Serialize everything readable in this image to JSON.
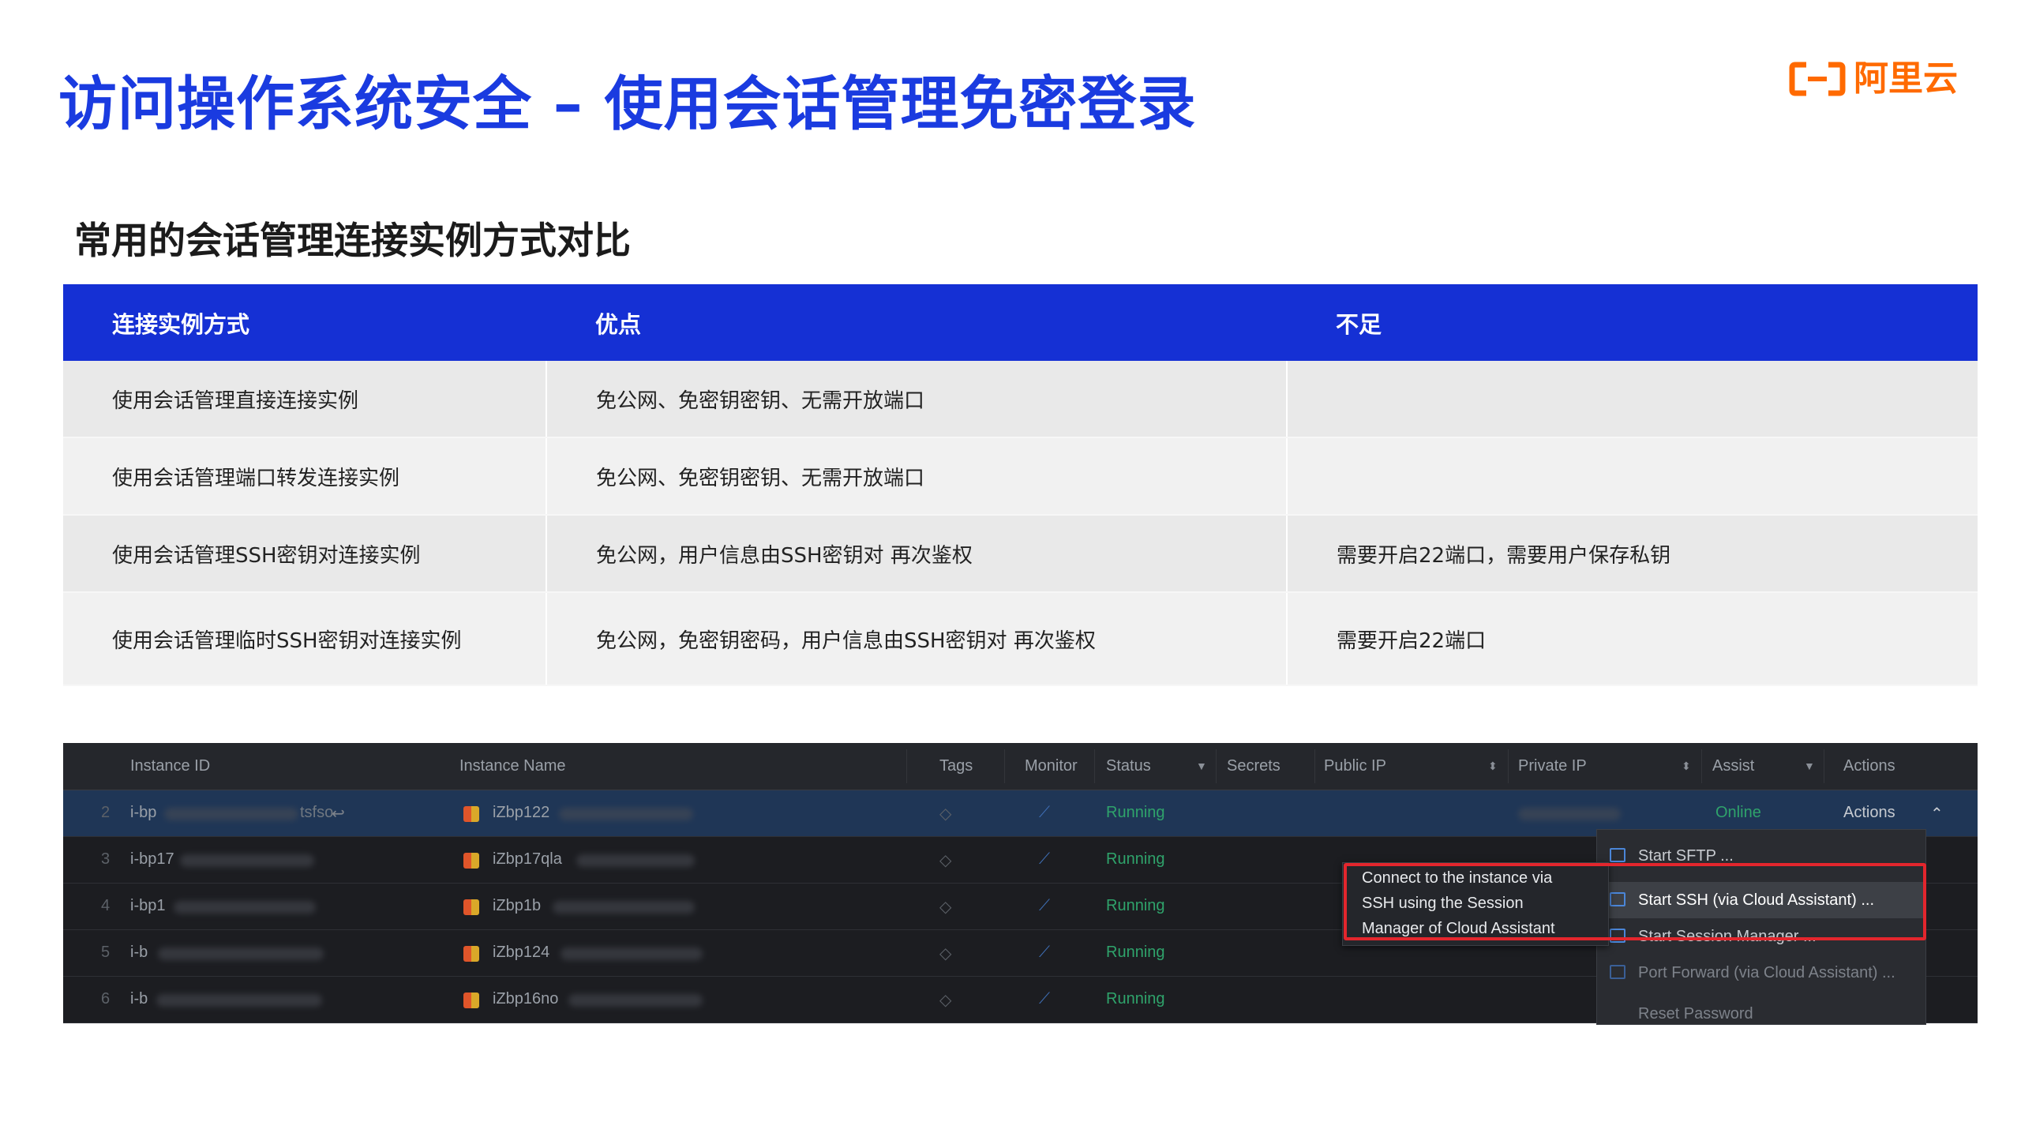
{
  "header": {
    "title": "访问操作系统安全 – 使用会话管理免密登录",
    "logo_text": "阿里云",
    "brand_color": "#ff6a00",
    "title_color": "#1a3be0"
  },
  "subtitle": "常用的会话管理连接实例方式对比",
  "comparison_table": {
    "header_color": "#1530d4",
    "columns": [
      "连接实例方式",
      "优点",
      "不足"
    ],
    "rows": [
      [
        "使用会话管理直接连接实例",
        "免公网、免密钥密钥、无需开放端口",
        ""
      ],
      [
        "使用会话管理端口转发连接实例",
        "免公网、免密钥密钥、无需开放端口",
        ""
      ],
      [
        "使用会话管理SSH密钥对连接实例",
        "免公网，用户信息由SSH密钥对 再次鉴权",
        "需要开启22端口，需要用户保存私钥"
      ],
      [
        "使用会话管理临时SSH密钥对连接实例",
        "免公网，免密钥密码，用户信息由SSH密钥对 再次鉴权",
        "需要开启22端口"
      ]
    ]
  },
  "console": {
    "columns": [
      "Instance ID",
      "Instance Name",
      "Tags",
      "Monitor",
      "Status",
      "Secrets",
      "Public IP",
      "Private IP",
      "Assist",
      "Actions"
    ],
    "rows": [
      {
        "num": "2",
        "id": "i-bp",
        "id_tail": "tsfso",
        "name": "iZbp122",
        "status": "Running",
        "assist": "Online",
        "actions": "Actions",
        "selected": true
      },
      {
        "num": "3",
        "id": "i-bp17",
        "name": "iZbp17qla",
        "status": "Running"
      },
      {
        "num": "4",
        "id": "i-bp1",
        "name": "iZbp1b",
        "status": "Running"
      },
      {
        "num": "5",
        "id": "i-b",
        "name": "iZbp124",
        "status": "Running"
      },
      {
        "num": "6",
        "id": "i-b",
        "name": "iZbp16no",
        "status": "Running"
      }
    ],
    "menu": [
      {
        "label": "Start SFTP ...",
        "icon": "sftp-icon",
        "state": "normal"
      },
      {
        "label": "Start SSH (via Cloud Assistant) ...",
        "icon": "ssh-icon",
        "state": "highlighted"
      },
      {
        "label": "Start Session Manager ...",
        "icon": "session-icon",
        "state": "normal"
      },
      {
        "label": "Port Forward (via Cloud Assistant) ...",
        "icon": "link-icon",
        "state": "dim"
      },
      {
        "label": "Reset Password",
        "icon": "",
        "state": "dim"
      }
    ],
    "tooltip": [
      "Connect to the instance via",
      "SSH using the Session",
      "Manager of Cloud Assistant"
    ],
    "highlight_color": "#e3262d",
    "status_color": "#2fa36b"
  }
}
